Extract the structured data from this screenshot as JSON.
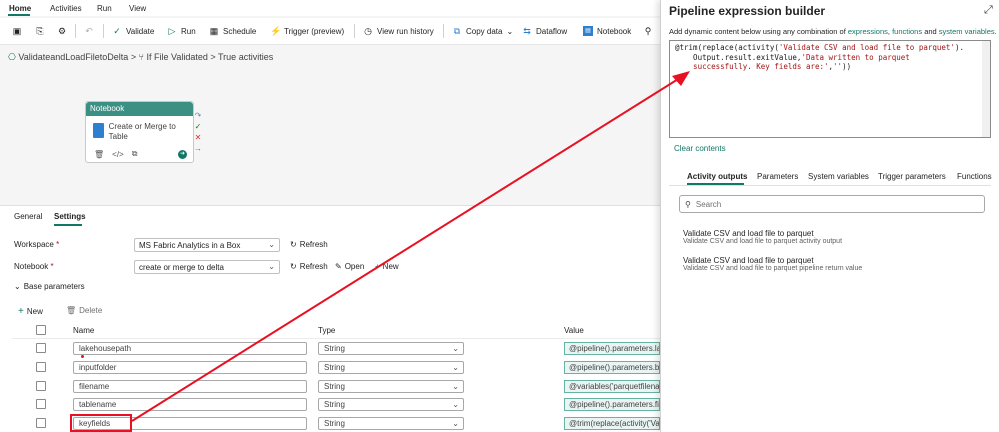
{
  "topnav": {
    "tabs": [
      "Home",
      "Activities",
      "Run",
      "View"
    ]
  },
  "toolbar": {
    "validate": "Validate",
    "run": "Run",
    "schedule": "Schedule",
    "trigger": "Trigger (preview)",
    "view_run_history": "View run history",
    "copy_data": "Copy data",
    "dataflow": "Dataflow",
    "notebook": "Notebook"
  },
  "breadcrumb": {
    "pipeline": "ValidateandLoadFiletoDelta",
    "activity": "If File Validated",
    "branch": "True activities",
    "separator": ">"
  },
  "node": {
    "title": "Notebook",
    "name": "Create or Merge to Table"
  },
  "bottom_tabs": [
    "General",
    "Settings"
  ],
  "settings": {
    "workspace_label": "Workspace",
    "workspace_value": "MS Fabric Analytics in a Box",
    "notebook_label": "Notebook",
    "notebook_value": "create or merge to delta",
    "refresh": "Refresh",
    "open": "Open",
    "new": "New",
    "base_parameters": "Base parameters",
    "add_new": "New",
    "delete": "Delete",
    "required_mark": "*"
  },
  "params": {
    "columns": [
      "Name",
      "Type",
      "Value"
    ],
    "rows": [
      {
        "name": "lakehousepath",
        "type": "String",
        "value": "@pipeline().parameters.lak"
      },
      {
        "name": "inputfolder",
        "type": "String",
        "value": "@pipeline().parameters.bro"
      },
      {
        "name": "filename",
        "type": "String",
        "value": "@variables('parquetfilenam"
      },
      {
        "name": "tablename",
        "type": "String",
        "value": "@pipeline().parameters.file"
      },
      {
        "name": "keyfields",
        "type": "String",
        "value": "@trim(replace(activity('Vali"
      }
    ]
  },
  "builder": {
    "title": "Pipeline expression builder",
    "description_prefix": "Add dynamic content below using any combination of ",
    "link_expressions": "expressions",
    "link_functions": "functions",
    "and_word": "and",
    "link_system_variables": "system variables",
    "expression_line1_a": "@trim(replace(activity(",
    "expression_line1_str": "'Validate CSV and load file to parquet'",
    "expression_line1_b": ").",
    "expression_line2_a": "    Output.result.exitValue,",
    "expression_line2_str": "'Data written to parquet",
    "expression_line3_str": "    successfully. Key fields are:'",
    "expression_line3_b": ",",
    "expression_line3_str2": "''",
    "expression_line3_c": "))",
    "clear_contents": "Clear contents",
    "tabs": [
      "Activity outputs",
      "Parameters",
      "System variables",
      "Trigger parameters",
      "Functions"
    ],
    "search_placeholder": "Search",
    "outputs": [
      {
        "title": "Validate CSV and load file to parquet",
        "subtitle": "Validate CSV and load file to parquet activity output"
      },
      {
        "title": "Validate CSV and load file to parquet",
        "subtitle": "Validate CSV and load file to parquet pipeline return value"
      }
    ]
  },
  "colors": {
    "accent": "#117865",
    "annotation": "#e81123",
    "node_header": "#3b8f83"
  }
}
